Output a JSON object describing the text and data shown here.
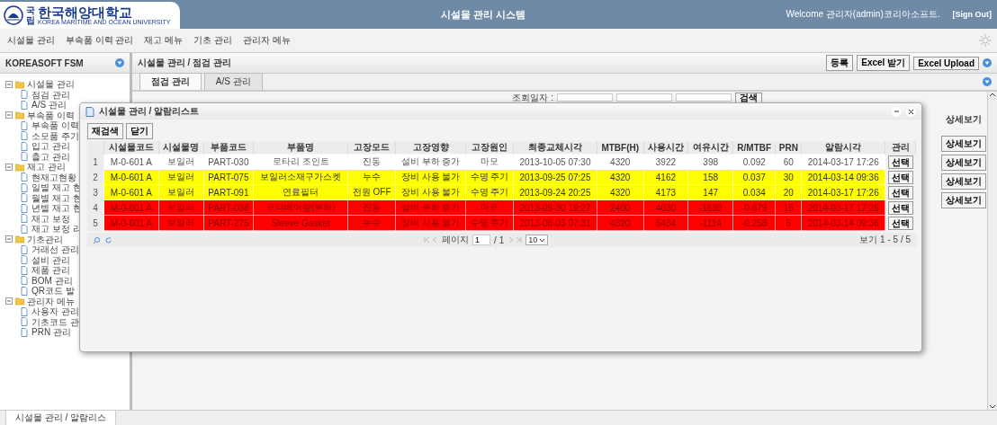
{
  "header": {
    "logo_badge": "국립",
    "logo_text": "한국해양대학교",
    "logo_subtext": "KOREA MARITIME AND OCEAN UNIVERSITY",
    "title": "시설물 관리 시스템",
    "welcome": "Welcome 관리자(admin)코리아소프트.",
    "sign_out": "[Sign Out]"
  },
  "menu": [
    "시설물 관리",
    "부속품 이력 관리",
    "재고 메뉴",
    "기초 관리",
    "관리자 메뉴"
  ],
  "sidebar": {
    "title": "KOREASOFT FSM",
    "tree": [
      {
        "label": "시설물 관리",
        "expanded": true,
        "children": [
          {
            "label": "점검 관리"
          },
          {
            "label": "A/S 관리"
          }
        ]
      },
      {
        "label": "부속품 이력",
        "expanded": true,
        "children": [
          {
            "label": "부속품 이력"
          },
          {
            "label": "소모품 주기"
          },
          {
            "label": "입고 관리"
          },
          {
            "label": "출고 관리"
          }
        ]
      },
      {
        "label": "재고 관리",
        "expanded": true,
        "children": [
          {
            "label": "현재고현황"
          },
          {
            "label": "일별 재고 현"
          },
          {
            "label": "월별 재고 현"
          },
          {
            "label": "년별 재고 현"
          },
          {
            "label": "재고 보정"
          },
          {
            "label": "재고 보정 리"
          }
        ]
      },
      {
        "label": "기초관리",
        "expanded": true,
        "children": [
          {
            "label": "거래선 관리"
          },
          {
            "label": "설비 관리"
          },
          {
            "label": "제품 관리"
          },
          {
            "label": "BOM 관리"
          },
          {
            "label": "QR코드 발"
          }
        ]
      },
      {
        "label": "관리자 메뉴",
        "expanded": true,
        "children": [
          {
            "label": "사용자 관리"
          },
          {
            "label": "기초코드 관"
          },
          {
            "label": "PRN 관리"
          }
        ]
      }
    ]
  },
  "main": {
    "breadcrumb": "시설물 관리 / 점검 관리",
    "actions": [
      "등록",
      "Excel 받기",
      "Excel Upload"
    ],
    "tabs": [
      {
        "label": "점검 관리",
        "selected": true
      },
      {
        "label": "A/S 관리",
        "selected": false
      }
    ],
    "search": {
      "label": "조회일자 :",
      "button": "검색"
    },
    "detail": {
      "header": "상세보기",
      "buttons": [
        "상세보기",
        "상세보기",
        "상세보기",
        "상세보기"
      ]
    }
  },
  "dialog": {
    "title": "시설물 관리 / 알람리스트",
    "toolbar": [
      "재검색",
      "닫기"
    ],
    "columns": [
      "",
      "시설물코드",
      "시설물명",
      "부품코드",
      "부품명",
      "고장모드",
      "고장영향",
      "고장원인",
      "최종교체시각",
      "MTBF(H)",
      "사용시간",
      "여유시간",
      "R/MTBF",
      "PRN",
      "알람시각",
      "관리"
    ],
    "rows": [
      {
        "color": "#ffffff",
        "cells": [
          "1",
          "M-0-601 A",
          "보일러",
          "PART-030",
          "로타리 조인트",
          "진동",
          "설비 부하 증가",
          "마모",
          "2013-10-05 07:30",
          "4320",
          "3922",
          "398",
          "0.092",
          "60",
          "2014-03-17 17:26"
        ],
        "action": "선택"
      },
      {
        "color": "#ffff00",
        "cells": [
          "2",
          "M-0-601 A",
          "보일러",
          "PART-075",
          "보일러소재구가스켓",
          "누수",
          "장비 사용 불가",
          "수명 주기",
          "2013-09-25 07:25",
          "4320",
          "4162",
          "158",
          "0.037",
          "30",
          "2014-03-14 09:36"
        ],
        "action": "선택"
      },
      {
        "color": "#ffff00",
        "cells": [
          "3",
          "M-0-601 A",
          "보일러",
          "PART-091",
          "연료필터",
          "전원 OFF",
          "장비 사용 불가",
          "수명 주기",
          "2013-09-24 20:25",
          "4320",
          "4173",
          "147",
          "0.034",
          "20",
          "2014-03-17 17:26"
        ],
        "action": "선택"
      },
      {
        "color": "#ff0000",
        "cells": [
          "4",
          "M-0-601 A",
          "보일러",
          "PART-038",
          "모터베어링(부하)",
          "진동",
          "설비 부하 증가",
          "마모",
          "2013-09-30 19:27",
          "2400",
          "4030",
          "-1630",
          "-0.679",
          "15",
          "2014-03-17 17:26"
        ],
        "action": "선택"
      },
      {
        "color": "#ff0000",
        "cells": [
          "5",
          "M-0-601 A",
          "보일러",
          "PART-275",
          "Sleeve Gasket",
          "누수",
          "장비 사용 불가",
          "수명 주기",
          "2013-08-03 07:31",
          "4320",
          "5434",
          "-1114",
          "-0.258",
          "5",
          "2014-03-14 09:36"
        ],
        "action": "선택"
      }
    ],
    "pager": {
      "page_label": "페이지",
      "page": "1",
      "total": "/ 1",
      "page_size": "10",
      "summary": "보기 1 - 5 / 5"
    }
  },
  "bottom_tab": "시설물 관리 / 알람리스"
}
